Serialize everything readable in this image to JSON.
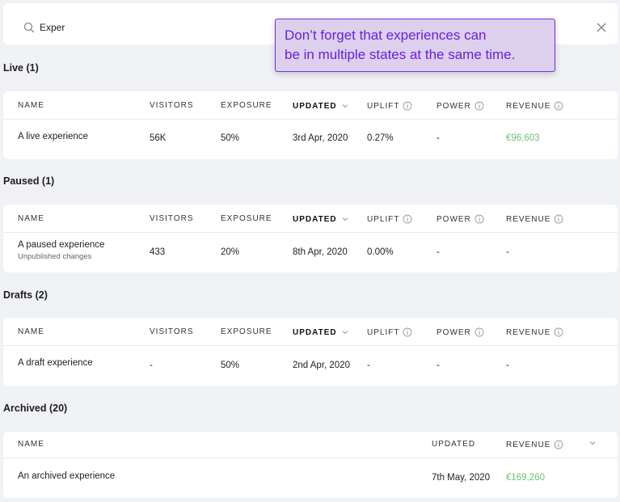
{
  "search": {
    "value": "Exper",
    "icon": "search-icon",
    "close_icon": "close-icon"
  },
  "tooltip": {
    "lines": [
      "Don’t forget that experiences can",
      "be in multiple states at the same time."
    ]
  },
  "columns": {
    "name": "NAME",
    "visitors": "VISITORS",
    "exposure": "EXPOSURE",
    "updated": "UPDATED",
    "uplift": "UPLIFT",
    "power": "POWER",
    "revenue": "REVENUE"
  },
  "sections": {
    "live": {
      "title": "Live (1)",
      "rows": [
        {
          "name": "A live experience",
          "visitors": "56K",
          "exposure": "50%",
          "updated": "3rd Apr, 2020",
          "uplift": "0.27%",
          "power": "-",
          "revenue": "€96,603"
        }
      ]
    },
    "paused": {
      "title": "Paused (1)",
      "rows": [
        {
          "name": "A paused experience",
          "note": "Unpublished changes",
          "visitors": "433",
          "exposure": "20%",
          "updated": "8th Apr, 2020",
          "uplift": "0.00%",
          "power": "-",
          "revenue": "-"
        }
      ]
    },
    "drafts": {
      "title": "Drafts (2)",
      "rows": [
        {
          "name": "A draft experience",
          "visitors": "-",
          "exposure": "50%",
          "updated": "2nd Apr, 2020",
          "uplift": "-",
          "power": "-",
          "revenue": "-"
        }
      ]
    },
    "archived": {
      "title": "Archived (20)",
      "rows": [
        {
          "name": "An archived experience",
          "updated": "7th May, 2020",
          "revenue": "€169,260"
        }
      ]
    }
  },
  "colors": {
    "accent": "#7b2be0",
    "tooltip_bg": "#dcd0ec",
    "revenue_positive": "#6ac07a",
    "background": "#f1f2f6"
  }
}
